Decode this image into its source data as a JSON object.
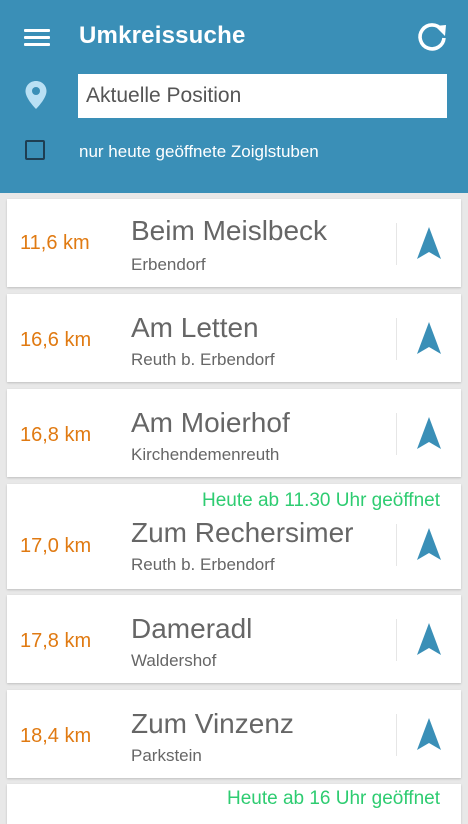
{
  "header": {
    "title": "Umkreissuche",
    "menu_icon": "menu-icon",
    "refresh_icon": "refresh-icon",
    "location_icon": "location-pin-icon",
    "bg_color": "#3a8fb7"
  },
  "search": {
    "value": "Aktuelle Position",
    "placeholder": "Aktuelle Position"
  },
  "filter": {
    "label": "nur heute geöffnete Zoiglstuben",
    "checked": false
  },
  "colors": {
    "distance": "#e07a12",
    "open_note": "#2ecc71",
    "nav_arrow": "#3a8fb7"
  },
  "results": [
    {
      "distance": "11,6 km",
      "name": "Beim Meislbeck",
      "place": "Erbendorf",
      "note": ""
    },
    {
      "distance": "16,6 km",
      "name": "Am Letten",
      "place": "Reuth b. Erbendorf",
      "note": ""
    },
    {
      "distance": "16,8 km",
      "name": "Am Moierhof",
      "place": "Kirchendemenreuth",
      "note": ""
    },
    {
      "distance": "17,0 km",
      "name": "Zum Rechersimer",
      "place": "Reuth b. Erbendorf",
      "note": "Heute ab 11.30 Uhr geöffnet"
    },
    {
      "distance": "17,8 km",
      "name": "Dameradl",
      "place": "Waldershof",
      "note": ""
    },
    {
      "distance": "18,4 km",
      "name": "Zum Vinzenz",
      "place": "Parkstein",
      "note": ""
    },
    {
      "distance": "",
      "name": "",
      "place": "",
      "note": "Heute ab 16 Uhr geöffnet"
    }
  ]
}
